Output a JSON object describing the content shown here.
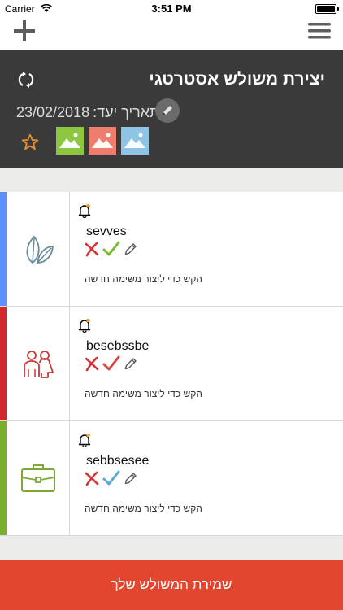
{
  "status_bar": {
    "carrier": "Carrier",
    "time": "3:51 PM",
    "battery_level": 1.0
  },
  "header": {
    "title": "יצירת משולש אסטרטגי",
    "date_label": "תאריך יעד:",
    "date_value": "23/02/2018"
  },
  "thumbs": [
    {
      "name": "thumb-green",
      "color": "#8dc63f"
    },
    {
      "name": "thumb-red",
      "color": "#ef7d6b"
    },
    {
      "name": "thumb-blue",
      "color": "#8ec5e4"
    }
  ],
  "rows": [
    {
      "name": "sevves",
      "hint": "הקש כדי ליצור משימה חדשה",
      "stripe_color": "#5b8ff9",
      "icon": "leaves-icon",
      "icon_color": "#6a8a9a",
      "check_color": "#7cbd2e"
    },
    {
      "name": "besebssbe",
      "hint": "הקש כדי ליצור משימה חדשה",
      "stripe_color": "#d0282e",
      "icon": "people-icon",
      "icon_color": "#c9383a",
      "check_color": "#d14a3e"
    },
    {
      "name": "sebbsesee",
      "hint": "הקש כדי ליצור משימה חדשה",
      "stripe_color": "#7cae2d",
      "icon": "briefcase-icon",
      "icon_color": "#7ca83a",
      "check_color": "#56a9d6"
    }
  ],
  "save_button": {
    "label": "שמירת המשולש שלך",
    "color": "#e2462f"
  }
}
